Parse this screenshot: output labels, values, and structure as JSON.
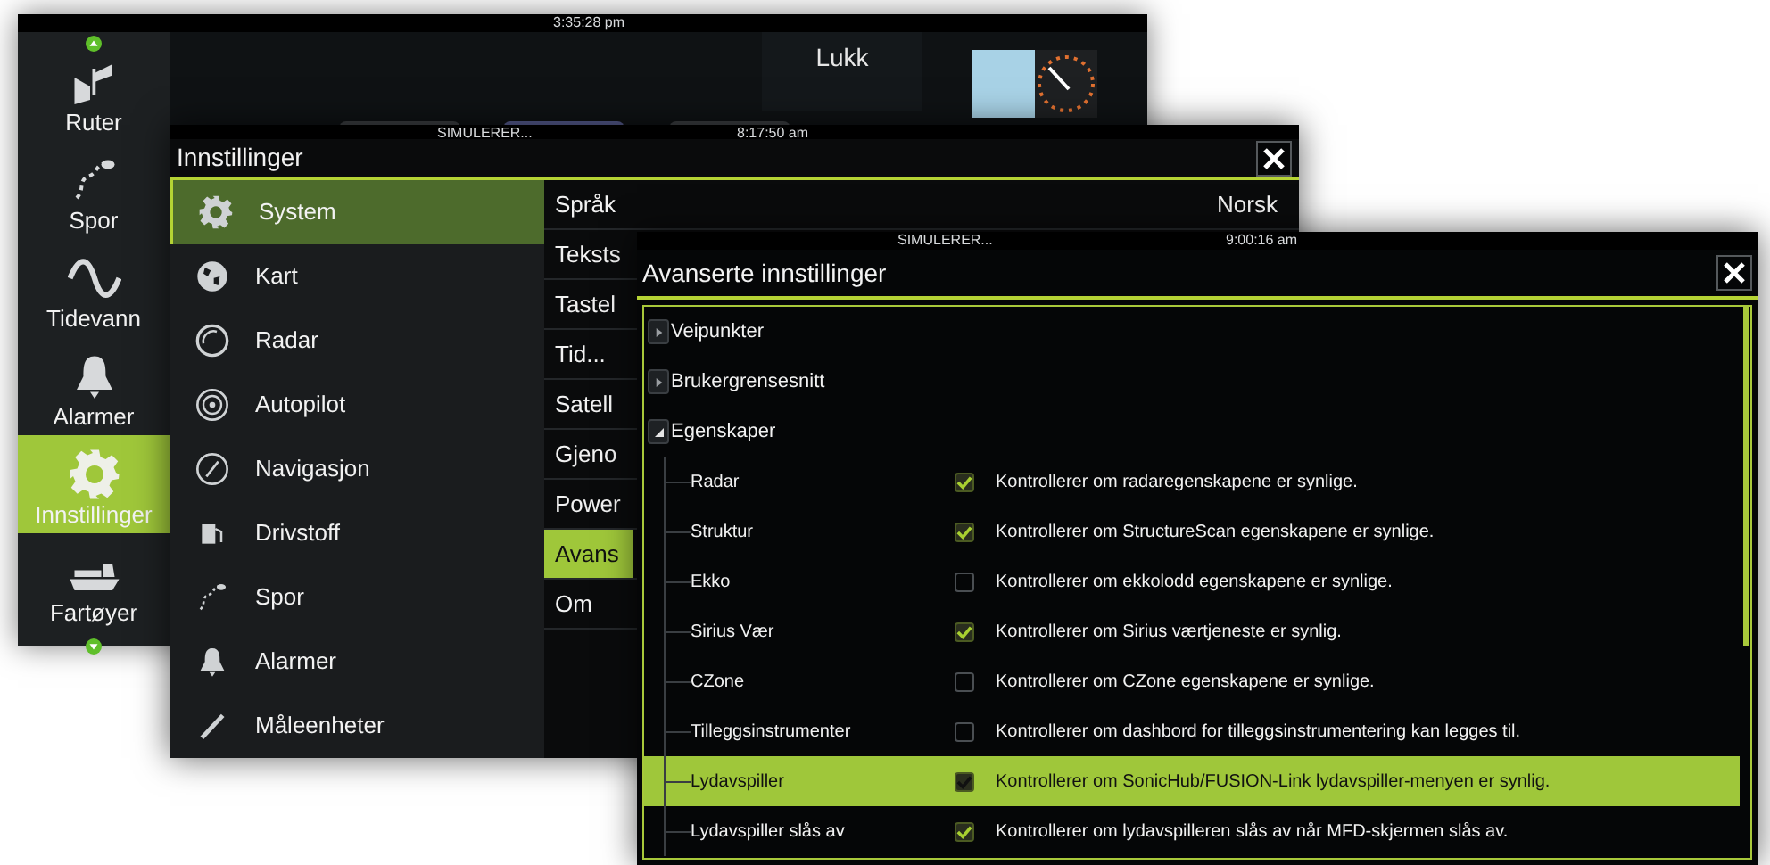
{
  "home_screen": {
    "clock": "3:35:28 pm",
    "close_label": "Lukk",
    "sidebar": [
      {
        "label": "Ruter",
        "kind": "routes",
        "selected": false
      },
      {
        "label": "Spor",
        "kind": "trail",
        "selected": false
      },
      {
        "label": "Tidevann",
        "kind": "tide",
        "selected": false
      },
      {
        "label": "Alarmer",
        "kind": "alarm",
        "selected": false
      },
      {
        "label": "Innstillinger",
        "kind": "settings",
        "selected": true
      },
      {
        "label": "Fartøyer",
        "kind": "vessel",
        "selected": false
      }
    ]
  },
  "settings_window": {
    "status": "SIMULERER...",
    "clock": "8:17:50 am",
    "title": "Innstillinger",
    "categories": [
      {
        "label": "System",
        "kind": "settings",
        "selected": true
      },
      {
        "label": "Kart",
        "kind": "chart",
        "selected": false
      },
      {
        "label": "Radar",
        "kind": "radar",
        "selected": false
      },
      {
        "label": "Autopilot",
        "kind": "autopilot",
        "selected": false
      },
      {
        "label": "Navigasjon",
        "kind": "navigation",
        "selected": false
      },
      {
        "label": "Drivstoff",
        "kind": "fuel",
        "selected": false
      },
      {
        "label": "Spor",
        "kind": "trail",
        "selected": false
      },
      {
        "label": "Alarmer",
        "kind": "alarm",
        "selected": false
      },
      {
        "label": "Måleenheter",
        "kind": "units",
        "selected": false
      }
    ],
    "options": [
      {
        "label": "Språk",
        "value": "Norsk",
        "selected": false
      },
      {
        "label": "Teksts",
        "selected": false
      },
      {
        "label": "Tastel",
        "selected": false
      },
      {
        "label": "Tid...",
        "selected": false
      },
      {
        "label": "Satell",
        "selected": false
      },
      {
        "label": "Gjeno",
        "selected": false
      },
      {
        "label": "Power",
        "selected": false
      },
      {
        "label": "Avans",
        "selected": true
      },
      {
        "label": "Om",
        "selected": false
      }
    ]
  },
  "advanced_window": {
    "status": "SIMULERER...",
    "clock": "9:00:16 am",
    "title": "Avanserte innstillinger",
    "tree": [
      {
        "label": "Veipunkter",
        "expanded": false,
        "selected": false
      },
      {
        "label": "Brukergrensesnitt",
        "expanded": false,
        "selected": false
      },
      {
        "label": "Egenskaper",
        "expanded": true,
        "selected": false,
        "children": [
          {
            "label": "Radar",
            "checked": true,
            "description": "Kontrollerer om radaregenskapene er synlige.",
            "selected": false
          },
          {
            "label": "Struktur",
            "checked": true,
            "description": "Kontrollerer om StructureScan egenskapene er synlige.",
            "selected": false
          },
          {
            "label": "Ekko",
            "checked": false,
            "description": "Kontrollerer om ekkolodd egenskapene er synlige.",
            "selected": false
          },
          {
            "label": "Sirius Vær",
            "checked": true,
            "description": "Kontrollerer om Sirius værtjeneste er synlig.",
            "selected": false
          },
          {
            "label": "CZone",
            "checked": false,
            "description": "Kontrollerer om CZone egenskapene er synlige.",
            "selected": false
          },
          {
            "label": "Tilleggsinstrumenter",
            "checked": false,
            "description": "Kontrollerer om dashbord for tilleggsinstrumentering kan legges til.",
            "selected": false
          },
          {
            "label": "Lydavspiller",
            "checked": true,
            "description": "Kontrollerer om SonicHub/FUSION-Link lydavspiller-menyen er synlig.",
            "selected": true
          },
          {
            "label": "Lydavspiller slås av",
            "checked": true,
            "description": "Kontrollerer om lydavspilleren slås av når MFD-skjermen slås av.",
            "selected": false
          }
        ]
      }
    ]
  }
}
